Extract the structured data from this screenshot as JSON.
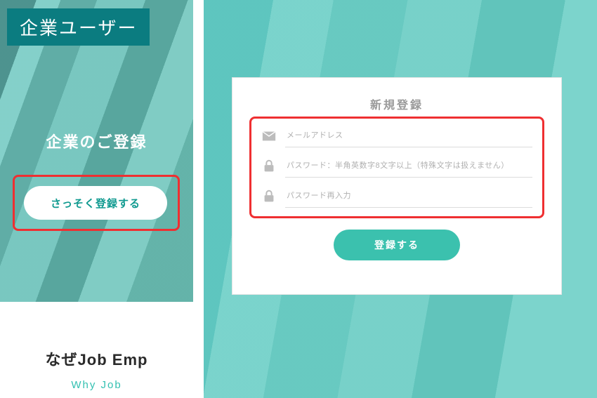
{
  "left": {
    "badge": "企業ユーザー",
    "heading": "企業のご登録",
    "cta_label": "さっそく登録する",
    "section_heading": "なぜJob Emp",
    "section_sub": "Why Job"
  },
  "form": {
    "title": "新規登録",
    "email_placeholder": "メールアドレス",
    "password_placeholder": "パスワード：半角英数字8文字以上（特殊文字は扱えません）",
    "password_confirm_placeholder": "パスワード再入力",
    "submit_label": "登録する"
  },
  "colors": {
    "accent": "#3bc1ae",
    "highlight": "#ef2f31",
    "badge_bg": "#0b7c80"
  }
}
